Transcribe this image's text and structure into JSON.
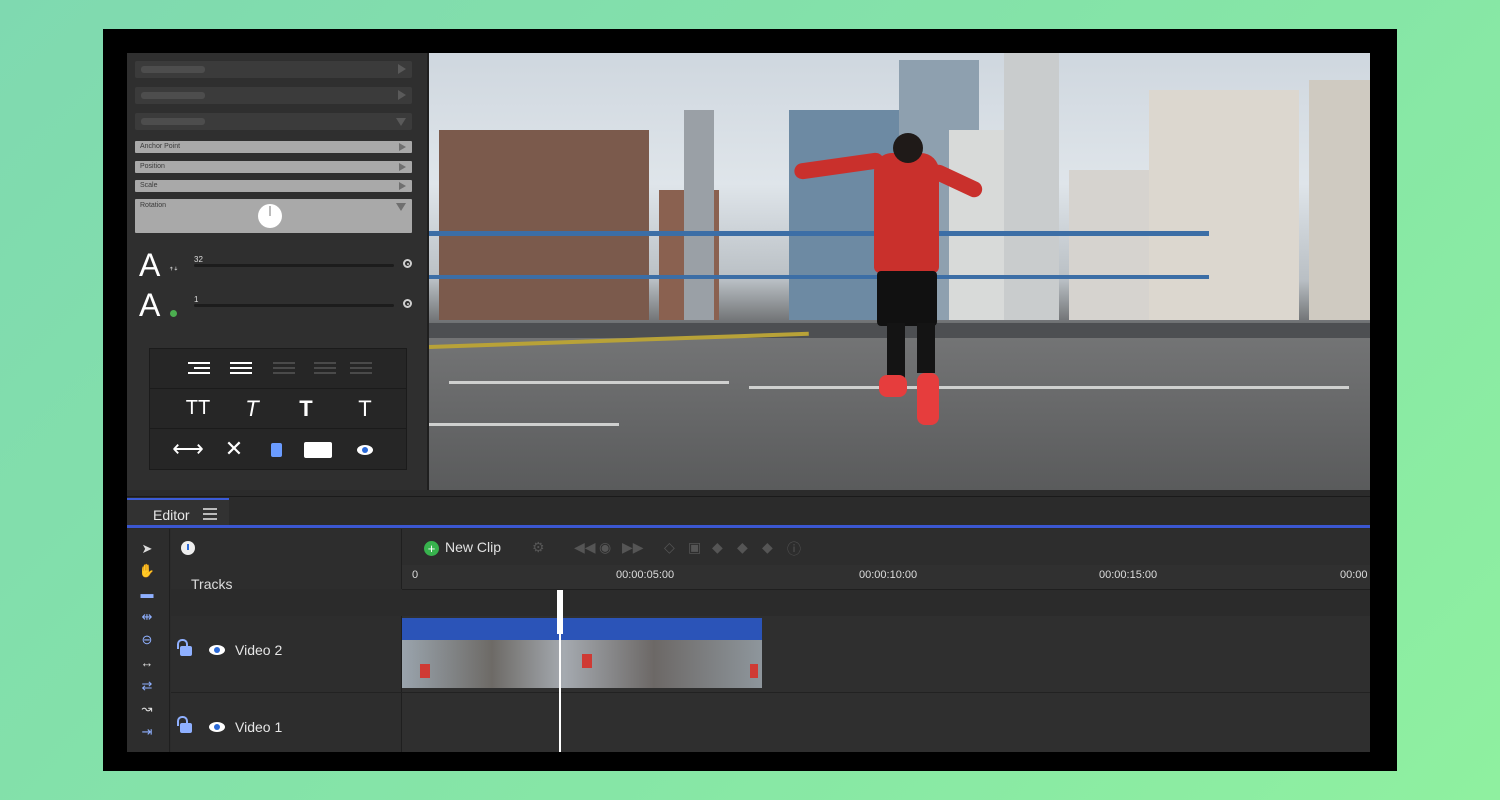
{
  "props": {
    "rows": [
      "",
      "",
      ""
    ],
    "transform": {
      "anchor_point": "Anchor Point",
      "position": "Position",
      "scale": "Scale",
      "rotation": "Rotation"
    },
    "font_size": {
      "glyph": "A",
      "value": "32"
    },
    "font_weight": {
      "glyph": "A",
      "value": "1"
    },
    "tools": {
      "row2": [
        "TT",
        "T",
        "T",
        "T"
      ]
    }
  },
  "editor": {
    "tab_label": "Editor",
    "tracks_label": "Tracks",
    "new_clip_label": "New Clip",
    "ruler": [
      "0",
      "00:00:05:00",
      "00:00:10:00",
      "00:00:15:00",
      "00:00"
    ],
    "tracks": [
      {
        "name": "Video 2"
      },
      {
        "name": "Video 1"
      }
    ]
  },
  "colors": {
    "accent": "#3b57d1",
    "clip_blue": "#2b54b8",
    "add_green": "#37b24d",
    "icon_blue": "#8fb0ff"
  }
}
